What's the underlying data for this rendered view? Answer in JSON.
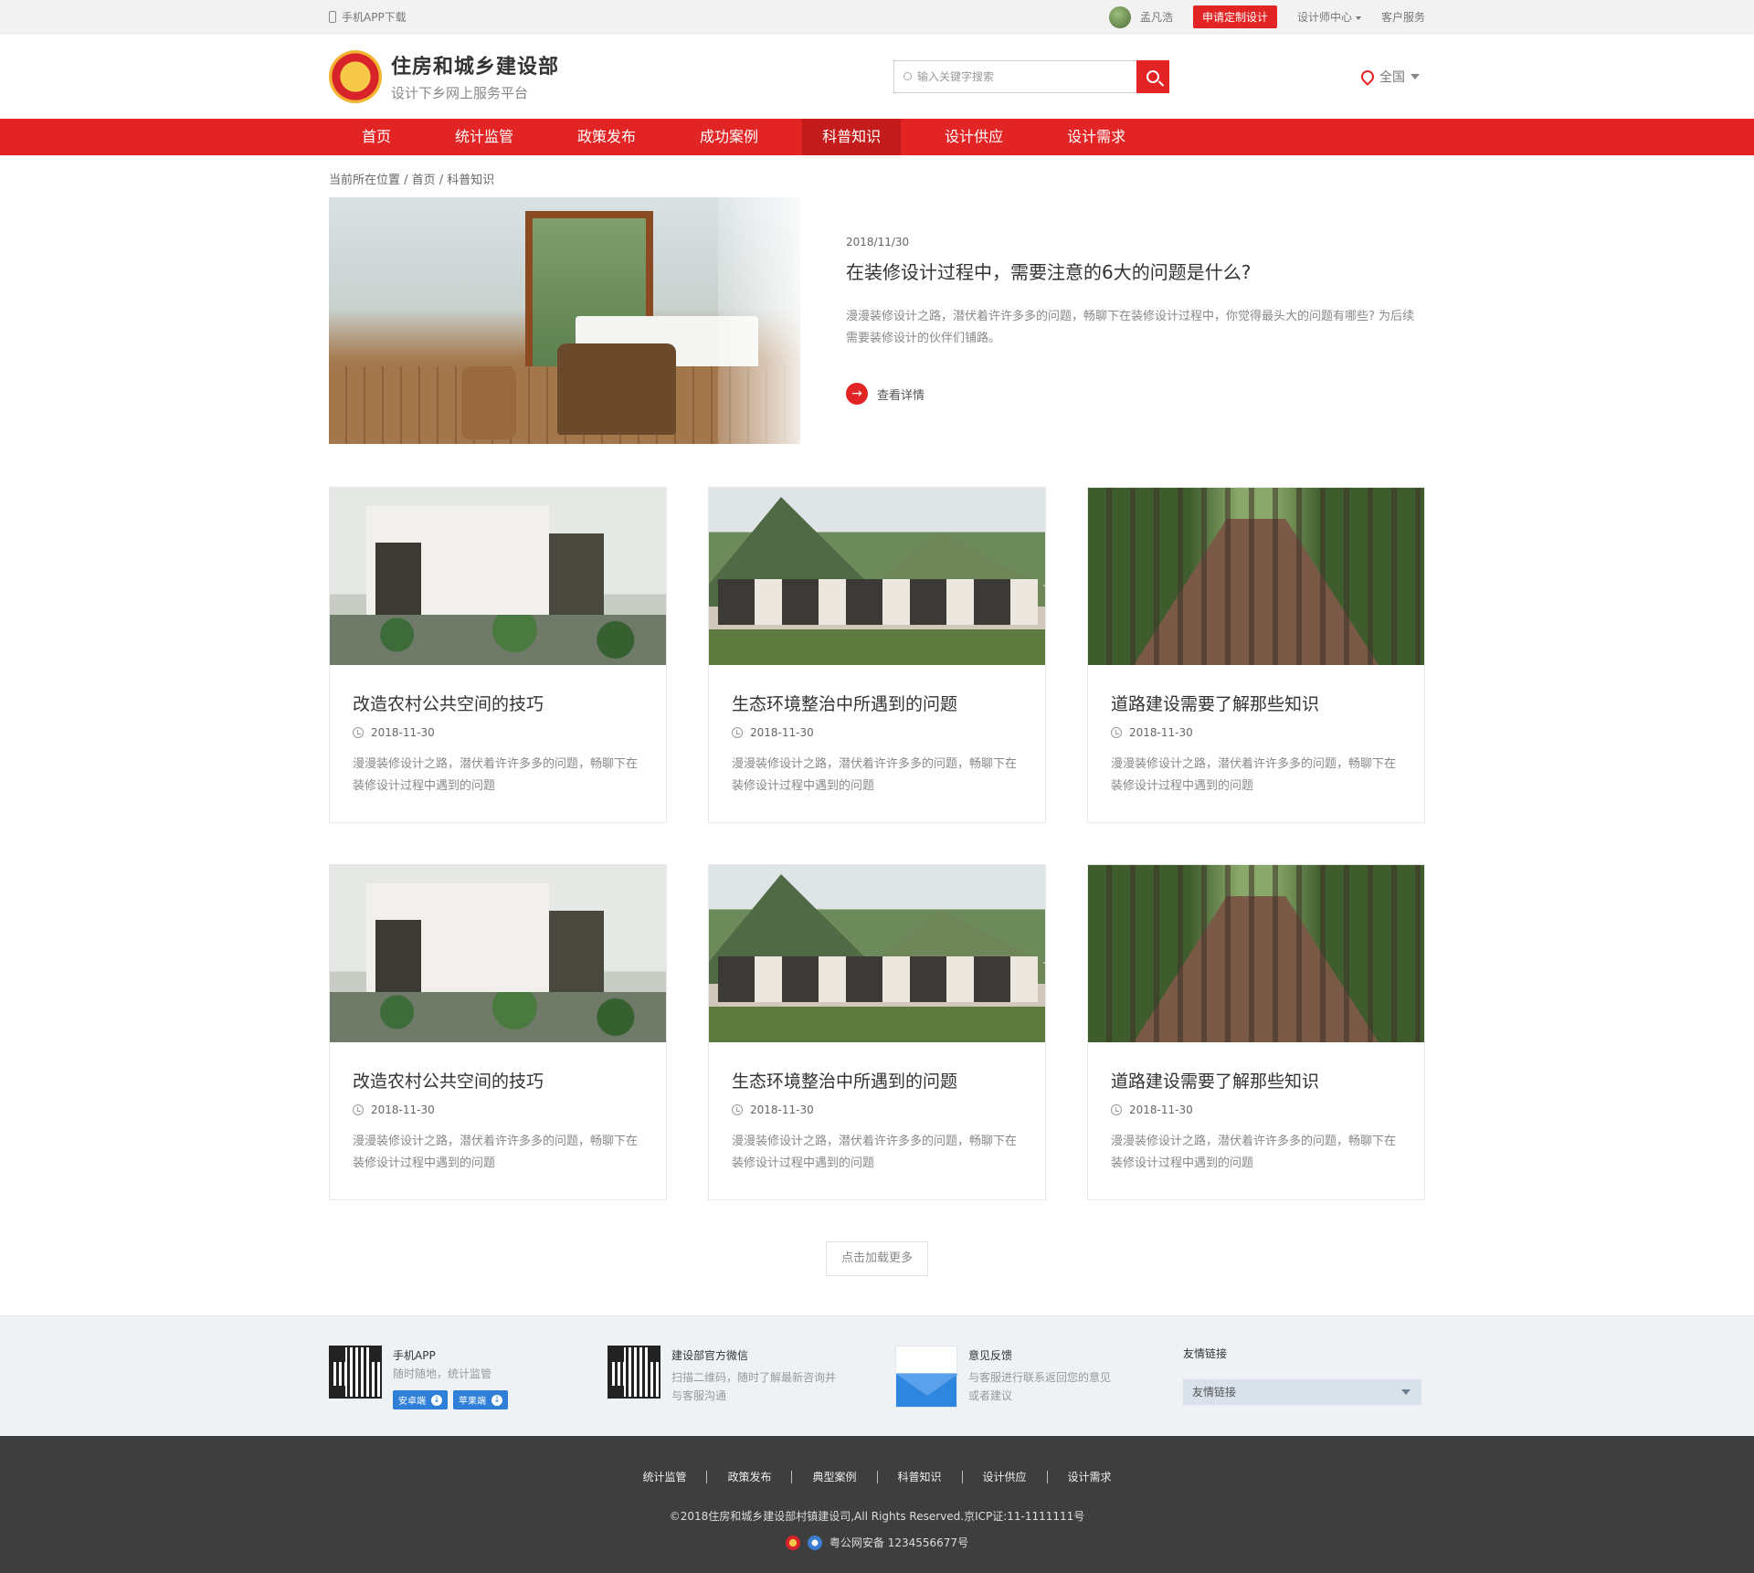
{
  "topbar": {
    "app_download": "手机APP下载",
    "username": "孟凡浩",
    "apply_btn": "申请定制设计",
    "designer_center": "设计师中心",
    "customer_service": "客户服务"
  },
  "header": {
    "title": "住房和城乡建设部",
    "subtitle": "设计下乡网上服务平台",
    "search_placeholder": "输入关键字搜索",
    "region": "全国"
  },
  "nav": {
    "items": [
      "首页",
      "统计监管",
      "政策发布",
      "成功案例",
      "科普知识",
      "设计供应",
      "设计需求"
    ],
    "active_index": 4
  },
  "breadcrumb": "当前所在位置 / 首页 / 科普知识",
  "featured": {
    "date": "2018/11/30",
    "title": "在装修设计过程中，需要注意的6大的问题是什么?",
    "desc": "漫漫装修设计之路，潜伏着许许多多的问题，畅聊下在装修设计过程中，你觉得最头大的问题有哪些? 为后续需要装修设计的伙伴们铺路。",
    "more": "查看详情"
  },
  "cards": [
    {
      "title": "改造农村公共空间的技巧",
      "date": "2018-11-30",
      "desc": "漫漫装修设计之路，潜伏着许许多多的问题，畅聊下在装修设计过程中遇到的问题"
    },
    {
      "title": "生态环境整治中所遇到的问题",
      "date": "2018-11-30",
      "desc": "漫漫装修设计之路，潜伏着许许多多的问题，畅聊下在装修设计过程中遇到的问题"
    },
    {
      "title": "道路建设需要了解那些知识",
      "date": "2018-11-30",
      "desc": "漫漫装修设计之路，潜伏着许许多多的问题，畅聊下在装修设计过程中遇到的问题"
    },
    {
      "title": "改造农村公共空间的技巧",
      "date": "2018-11-30",
      "desc": "漫漫装修设计之路，潜伏着许许多多的问题，畅聊下在装修设计过程中遇到的问题"
    },
    {
      "title": "生态环境整治中所遇到的问题",
      "date": "2018-11-30",
      "desc": "漫漫装修设计之路，潜伏着许许多多的问题，畅聊下在装修设计过程中遇到的问题"
    },
    {
      "title": "道路建设需要了解那些知识",
      "date": "2018-11-30",
      "desc": "漫漫装修设计之路，潜伏着许许多多的问题，畅聊下在装修设计过程中遇到的问题"
    }
  ],
  "load_more": "点击加载更多",
  "footer_info": {
    "app_title": "手机APP",
    "app_sub": "随时随地，统计监管",
    "android": "安卓端",
    "ios": "苹果端",
    "wechat_title": "建设部官方微信",
    "wechat_sub": "扫描二维码，随时了解最新咨询并与客服沟通",
    "feedback_title": "意见反馈",
    "feedback_sub": "与客服进行联系返回您的意见或者建议",
    "links_title": "友情链接",
    "links_select": "友情链接"
  },
  "footer": {
    "links": [
      "统计监管",
      "政策发布",
      "典型案例",
      "科普知识",
      "设计供应",
      "设计需求"
    ],
    "copyright": "©2018住房和城乡建设部村镇建设司,All Rights Reserved.京ICP证:11-1111111号",
    "police": "粤公网安备 1234556677号"
  },
  "colors": {
    "accent": "#e32424",
    "nav_active": "#c41c1c",
    "footer_dark": "#3e3e3e",
    "link_blue": "#2f7fd8"
  }
}
